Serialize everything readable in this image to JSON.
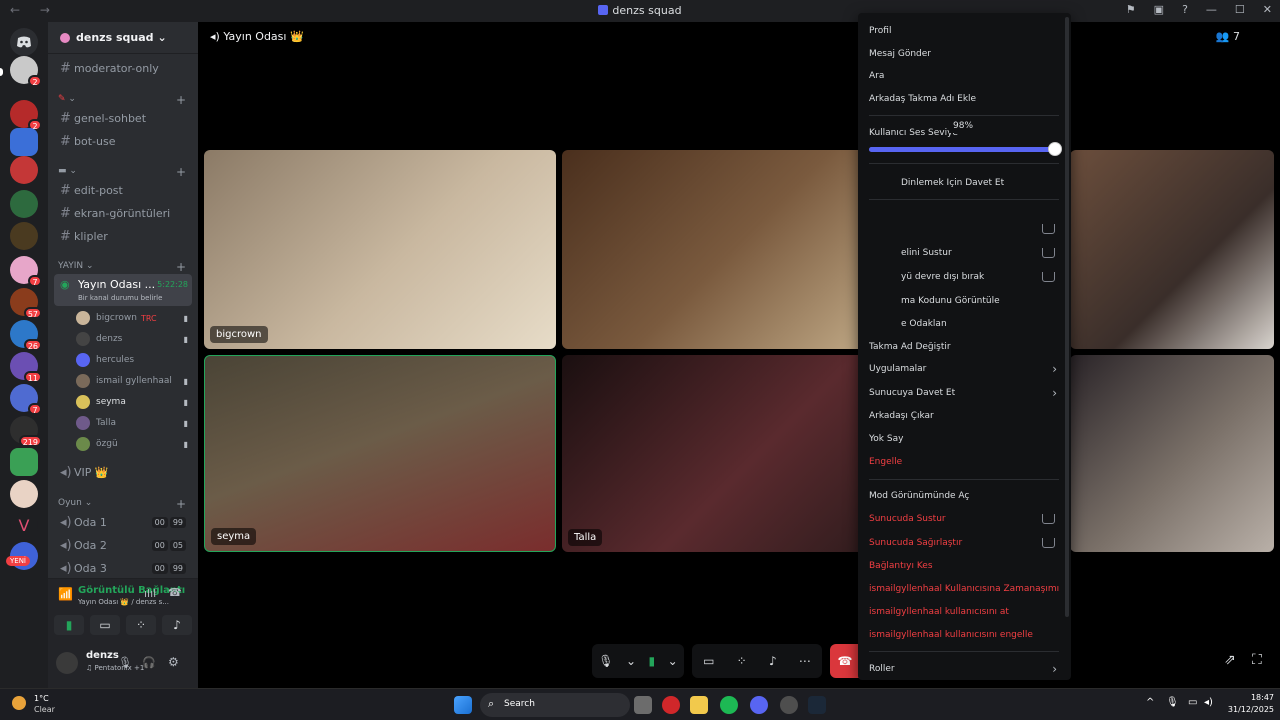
{
  "window": {
    "title": "denzs squad",
    "nav_glyphs": "← →",
    "controls": [
      "⚑",
      "▣",
      "?",
      "—",
      "☐",
      "✕"
    ]
  },
  "guild_badges": [
    "2",
    "2",
    "7",
    "57",
    "26",
    "11",
    "7",
    "219",
    "YENİ"
  ],
  "sidebar": {
    "server_name": "denzs squad",
    "channels_top": [
      "moderator-only"
    ],
    "channels_group1": [
      "genel-sohbet",
      "bot-use"
    ],
    "channels_group2": [
      "edit-post",
      "ekran-görüntüleri",
      "klipler"
    ],
    "category_yayin": "YAYIN",
    "active_voice": {
      "name": "Yayın Odası ...",
      "time": "5:22:28",
      "status": "Bir kanal durumu belirle"
    },
    "voice_users": [
      "bigcrown",
      "denzs",
      "hercules",
      "ismail gyllenhaal",
      "seyma",
      "Talla",
      "özgü"
    ],
    "bigcrown_tag": "TRC",
    "vip": "VIP 👑",
    "category_oyun": "Oyun",
    "oda": [
      {
        "name": "Oda 1",
        "a": "00",
        "b": "99"
      },
      {
        "name": "Oda 2",
        "a": "00",
        "b": "05"
      },
      {
        "name": "Oda 3",
        "a": "00",
        "b": "99"
      }
    ]
  },
  "voice_panel": {
    "title": "Görüntülü Bağlantı",
    "subtitle": "Yayın Odası 👑 / denzs s..."
  },
  "user_panel": {
    "name": "denzs",
    "status": "♫ Pentatonix +1"
  },
  "stage": {
    "channel_title": "Yayın Odası 👑",
    "member_count": "7",
    "tiles": [
      {
        "name": "bigcrown"
      },
      {
        "name": ""
      },
      {
        "name": ""
      },
      {
        "name": "seyma"
      },
      {
        "name": "Talla"
      },
      {
        "name": ""
      }
    ]
  },
  "menu": {
    "profil": "Profil",
    "mesaj": "Mesaj Gönder",
    "ara": "Ara",
    "takma": "Arkadaş Takma Adı Ekle",
    "volume_label": "Kullanıcı Ses Seviye",
    "volume_value": "98%",
    "volume_fraction": 0.98,
    "dinlemek": "Dinlemek İçin Davet Et",
    "sustur": "elini Sustur",
    "devre": "yü devre dışı bırak",
    "kodu": "ma Kodunu Görüntüle",
    "odaklan": "e Odaklan",
    "ad": "Takma Ad Değiştir",
    "uygulamalar": "Uygulamalar",
    "sunucuya": "Sunucuya Davet Et",
    "cikar": "Arkadaşı Çıkar",
    "yoksay": "Yok Say",
    "engelle": "Engelle",
    "mod": "Mod Görünümünde Aç",
    "sunucu_sustur": "Sunucuda Sustur",
    "sunucu_sagir": "Sunucuda Sağırlaştır",
    "baglanti": "Bağlantıyı Kes",
    "zaman": "ismailgyllenhaal Kullanıcısına Zamanaşımı Uyg...",
    "at": "ismailgyllenhaal kullanıcısını at",
    "engelle2": "ismailgyllenhaal kullanıcısını engelle",
    "roller": "Roller"
  },
  "taskbar": {
    "weather_temp": "1°C",
    "weather_text": "Clear",
    "search": "Search",
    "time": "18:47",
    "date": "31/12/2025"
  }
}
